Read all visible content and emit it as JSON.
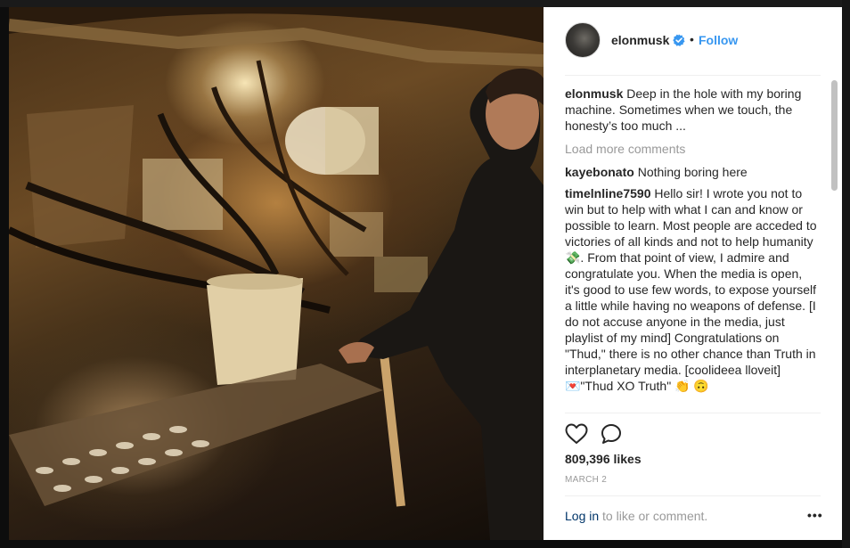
{
  "post": {
    "username": "elonmusk",
    "separator": "•",
    "follow_label": "Follow",
    "caption": {
      "user": "elonmusk",
      "text": "Deep in the hole with my boring machine. Sometimes when we touch, the honesty’s too much ..."
    },
    "load_more": "Load more comments",
    "comments": [
      {
        "user": "kayebonato",
        "text": "Nothing boring here"
      },
      {
        "user": "timelnline7590",
        "text": "Hello sir! I wrote you not to win but to help with what I can and know or possible to learn. Most people are acceded to victories of all kinds and not to help humanity💸. From that point of view, I admire and congratulate you. When the media is open, it's good to use few words, to expose yourself a little while having no weapons of defense. [I do not accuse anyone in the media, just playlist of my mind] Congratulations on \"Thud,\" there is no other chance than Truth in interplanetary media. [coolideea lloveit] 💌\"Thud XO Truth\" 👏 🙃"
      }
    ],
    "likes": "809,396 likes",
    "date": "MARCH 2",
    "login_link": "Log in",
    "login_suffix": " to like or comment.",
    "more_options": "•••"
  },
  "icons": {
    "verified": "verified-badge-icon",
    "like": "heart-icon",
    "comment": "comment-bubble-icon",
    "options": "more-options-icon"
  },
  "colors": {
    "link_blue": "#3897f0",
    "verified_blue": "#3897f0",
    "muted_gray": "#999999",
    "text_dark": "#262626"
  }
}
